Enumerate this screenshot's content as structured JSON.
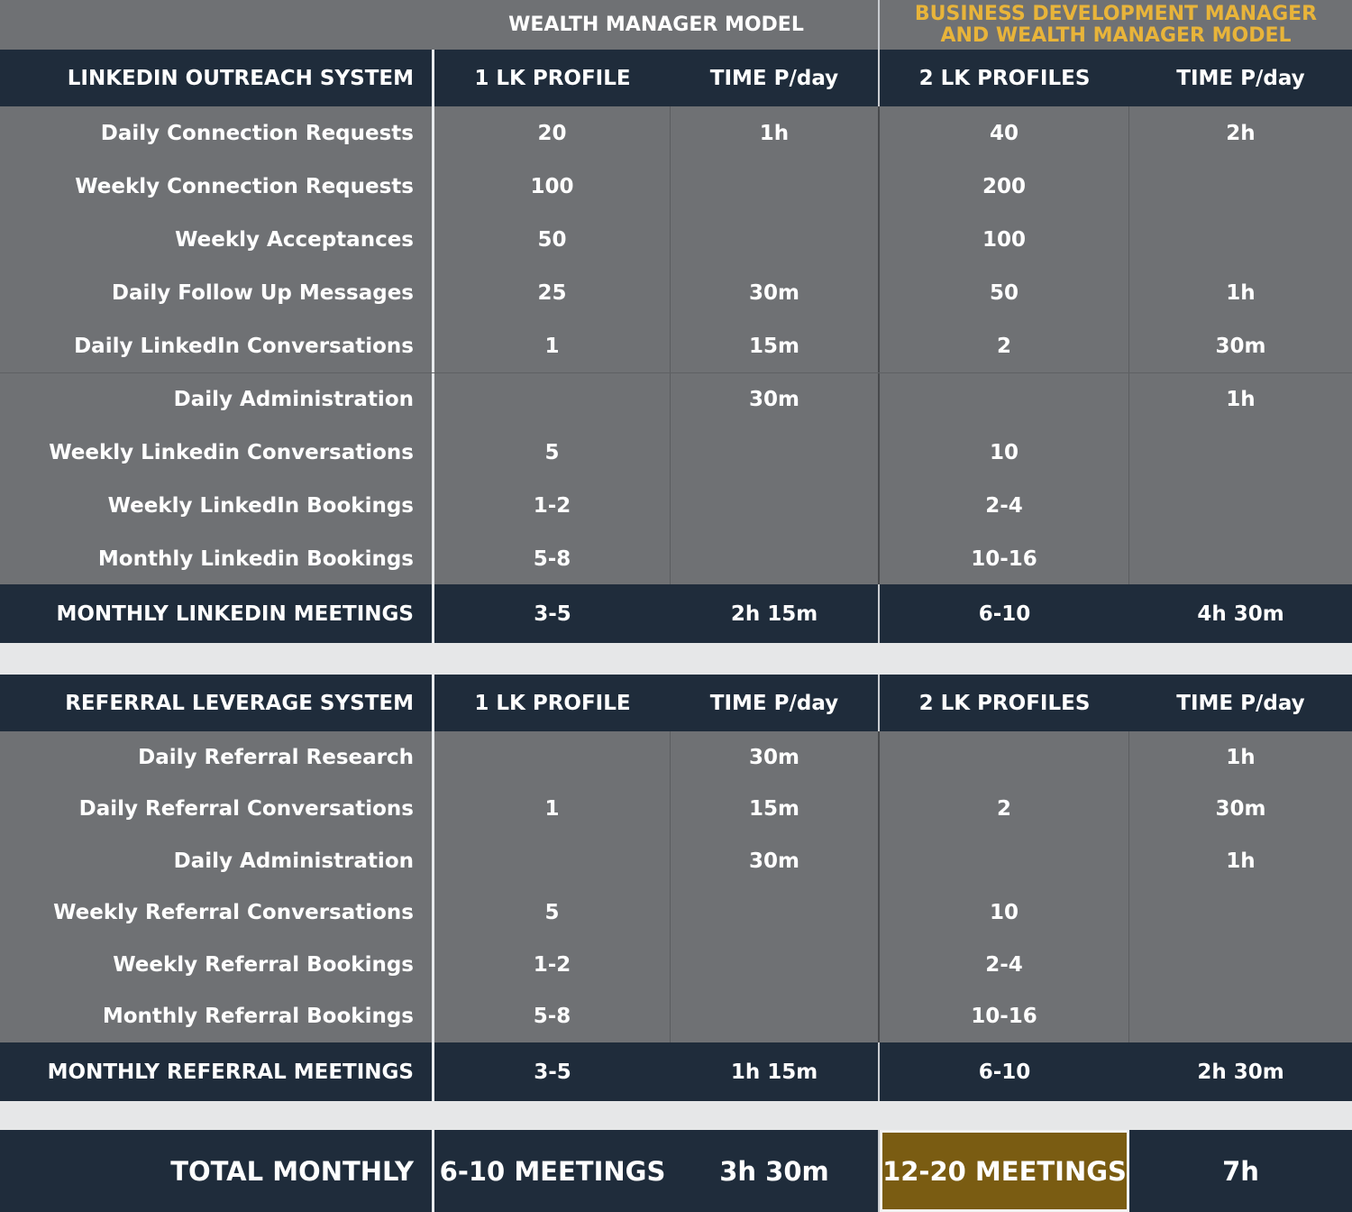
{
  "header": {
    "wm_model": "WEALTH MANAGER MODEL",
    "bdm_model_line1": "BUSINESS DEVELOPMENT MANAGER",
    "bdm_model_line2": "AND WEALTH MANAGER MODEL"
  },
  "linkedin": {
    "columns": [
      "LINKEDIN OUTREACH SYSTEM",
      "1 LK PROFILE",
      "TIME P/day",
      "2 LK PROFILES",
      "TIME P/day"
    ],
    "rows": [
      [
        "Daily Connection Requests",
        "20",
        "1h",
        "40",
        "2h"
      ],
      [
        "Weekly Connection Requests",
        "100",
        "",
        "200",
        ""
      ],
      [
        "Weekly Acceptances",
        "50",
        "",
        "100",
        ""
      ],
      [
        "Daily Follow Up Messages",
        "25",
        "30m",
        "50",
        "1h"
      ],
      [
        "Daily LinkedIn Conversations",
        "1",
        "15m",
        "2",
        "30m"
      ],
      [
        "Daily Administration",
        "",
        "30m",
        "",
        "1h"
      ],
      [
        "Weekly Linkedin Conversations",
        "5",
        "",
        "10",
        ""
      ],
      [
        "Weekly LinkedIn Bookings",
        "1-2",
        "",
        "2-4",
        ""
      ],
      [
        "Monthly Linkedin Bookings",
        "5-8",
        "",
        "10-16",
        ""
      ]
    ],
    "total": [
      "MONTHLY LINKEDIN MEETINGS",
      "3-5",
      "2h 15m",
      "6-10",
      "4h 30m"
    ]
  },
  "referral": {
    "columns": [
      "REFERRAL LEVERAGE SYSTEM",
      "1 LK PROFILE",
      "TIME P/day",
      "2 LK PROFILES",
      "TIME P/day"
    ],
    "rows": [
      [
        "Daily Referral Research",
        "",
        "30m",
        "",
        "1h"
      ],
      [
        "Daily Referral Conversations",
        "1",
        "15m",
        "2",
        "30m"
      ],
      [
        "Daily Administration",
        "",
        "30m",
        "",
        "1h"
      ],
      [
        "Weekly Referral Conversations",
        "5",
        "",
        "10",
        ""
      ],
      [
        "Weekly Referral Bookings",
        "1-2",
        "",
        "2-4",
        ""
      ],
      [
        "Monthly Referral Bookings",
        "5-8",
        "",
        "10-16",
        ""
      ]
    ],
    "total": [
      "MONTHLY REFERRAL MEETINGS",
      "3-5",
      "1h 15m",
      "6-10",
      "2h 30m"
    ]
  },
  "grand_total": [
    "TOTAL MONTHLY",
    "6-10 MEETINGS",
    "3h 30m",
    "12-20 MEETINGS",
    "7h"
  ],
  "colors": {
    "navy": "#1f2c3b",
    "gray": "#6f7174",
    "gold_text": "#e8b43a",
    "gold_fill": "#7a5c12"
  }
}
